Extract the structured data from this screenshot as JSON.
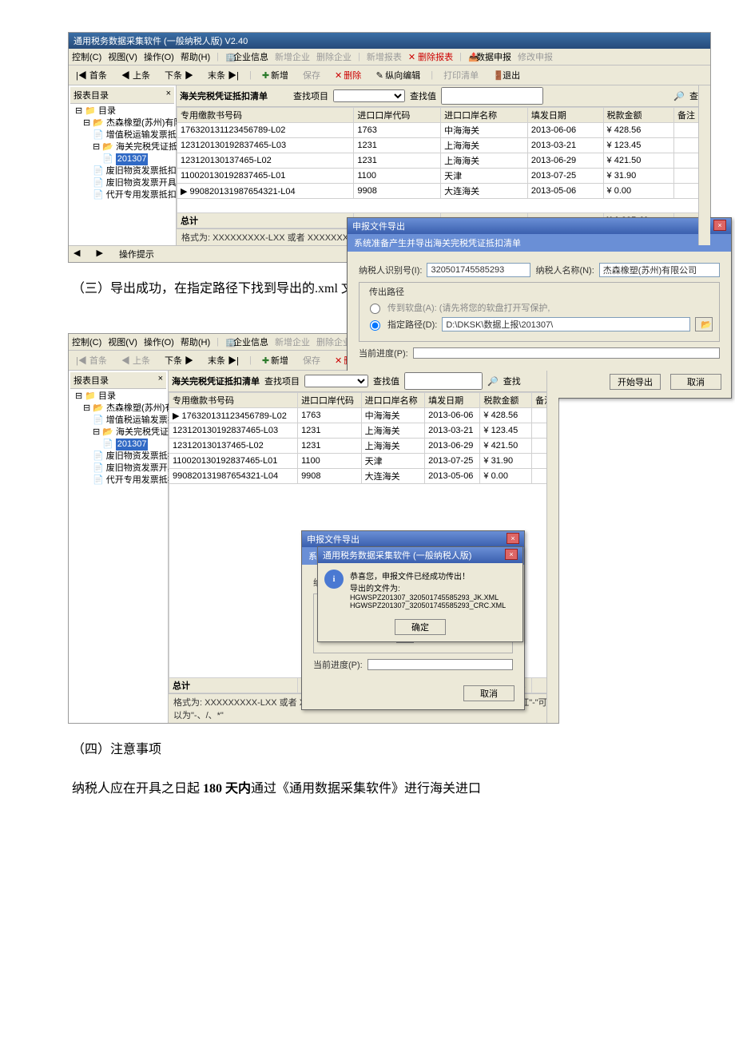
{
  "app": {
    "title": "通用税务数据采集软件 (一般纳税人版) V2.40"
  },
  "menu": {
    "control": "控制(C)",
    "view": "视图(V)",
    "operate": "操作(O)",
    "help": "帮助(H)"
  },
  "tb": {
    "ent_info": "企业信息",
    "add_ent": "新增企业",
    "del_ent": "删除企业",
    "add_rpt": "新增报表",
    "del_rpt": "删除报表",
    "data_submit": "数据申报",
    "mod_submit": "修改申报",
    "first": "|◀ 首条",
    "prev": "◀ 上条",
    "next": "下条 ▶",
    "last": "末条 ▶|",
    "add": "新增",
    "save": "保存",
    "delete": "删除",
    "col_edit": "纵向编辑",
    "print": "打印清单",
    "exit": "退出"
  },
  "sidebar": {
    "title": "报表目录",
    "close": "×",
    "root": "目录",
    "company": "杰森橡塑(苏州)有限公司",
    "items": [
      "增值税运输发票抵扣清单",
      "海关完税凭证抵扣清单",
      "201307",
      "废旧物资发票抵扣清单",
      "废旧物资发票开具清单",
      "代开专用发票抵扣清单"
    ]
  },
  "gridbar": {
    "title": "海关完税凭证抵扣清单",
    "q_item": "查找项目",
    "q_val": "查找值",
    "find": "查找",
    "find_icon": "🔎"
  },
  "columns": [
    "专用缴款书号码",
    "进口口岸代码",
    "进口口岸名称",
    "填发日期",
    "税款金额",
    "备注"
  ],
  "rows": [
    {
      "code": "176320131123456789-L02",
      "port": "1763",
      "name": "中海海关",
      "date": "2013-06-06",
      "amt": "¥ 428.56"
    },
    {
      "code": "123120130192837465-L03",
      "port": "1231",
      "name": "上海海关",
      "date": "2013-03-21",
      "amt": "¥ 123.45"
    },
    {
      "code": "123120130137465-L02",
      "port": "1231",
      "name": "上海海关",
      "date": "2013-06-29",
      "amt": "¥ 421.50"
    },
    {
      "code": "110020130192837465-L01",
      "port": "1100",
      "name": "天津",
      "date": "2013-07-25",
      "amt": "¥ 31.90"
    },
    {
      "code": "990820131987654321-L04",
      "port": "9908",
      "name": "大连海关",
      "date": "2013-05-06",
      "amt": "¥ 0.00"
    }
  ],
  "total": {
    "label": "总计",
    "amt": "¥ 1,005.41"
  },
  "hint": "格式为: XXXXXXXXX-LXX 或者 XXXXXXXXXXXXXXXXXX-LXX  其中\"X\"为0~9的数字, 横杠\"-\"可以为\"-、/、*\"",
  "status": {
    "tip": "操作提示"
  },
  "dlg": {
    "title": "申报文件导出",
    "sub": "系统准备产生并导出海关完税凭证抵扣清单",
    "id_label": "纳税人识别号(I):",
    "id_value": "320501745585293",
    "name_label": "纳税人名称(N):",
    "name_value": "杰森橡塑(苏州)有限公司",
    "out_legend": "传出路径",
    "floppy": "传到软盘(A): (请先将您的软盘打开写保护,",
    "path_label": "指定路径(D):",
    "path_value": "D:\\DKSK\\数据上报\\201307\\",
    "prog_label": "当前进度(P):",
    "start": "开始导出",
    "cancel": "取消",
    "close_x": "×"
  },
  "narrative": {
    "p1": "（三）导出成功，在指定路径下找到导出的.xml 文件（如下图）。",
    "h4": "（四）注意事项",
    "p2a": "纳税人应在开具之日起 ",
    "p2b": "180 天内",
    "p2c": "通过《通用数据采集软件》进行海关进口"
  },
  "msgbox": {
    "title": "通用税务数据采集软件 (一般纳税人版)",
    "line1": "恭喜您，申报文件已经成功传出！",
    "line2": "导出的文件为:",
    "file1": "HGWSPZ201307_320501745585293_JK.XML",
    "file2": "HGWSPZ201307_320501745585293_CRC.XML",
    "ok": "确定"
  }
}
